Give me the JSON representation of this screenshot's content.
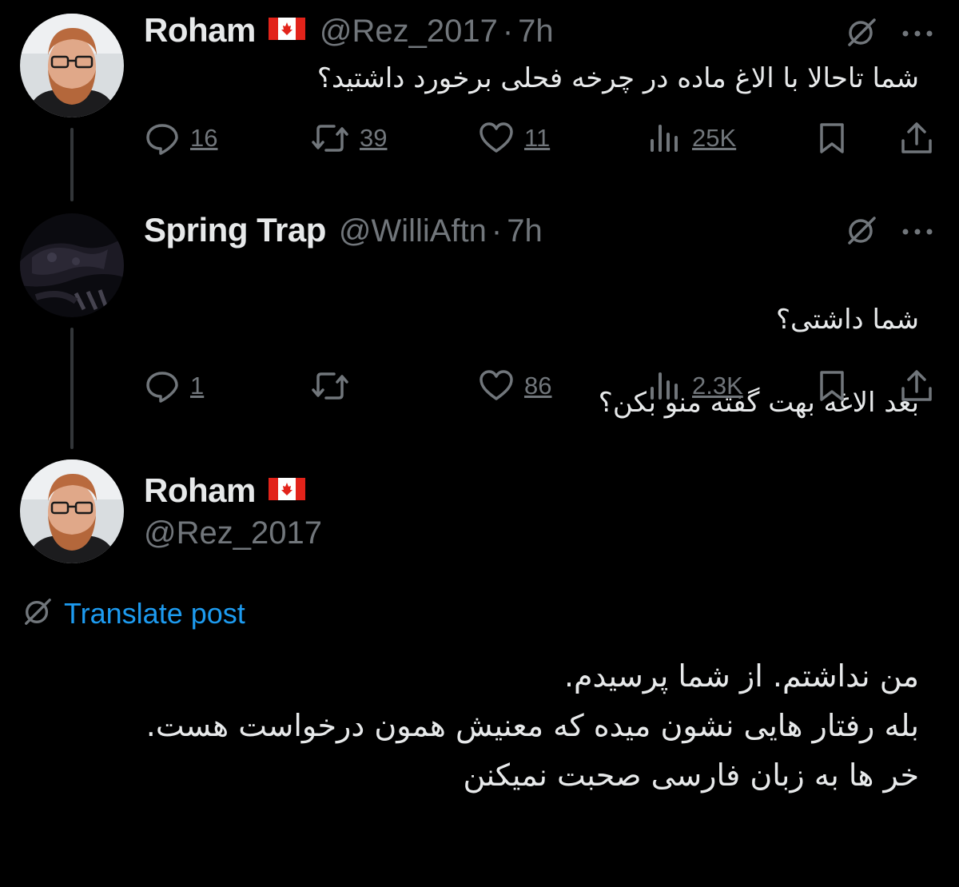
{
  "colors": {
    "background": "#000000",
    "text_primary": "#e7e9ea",
    "text_secondary": "#71767b",
    "link": "#1d9bf0"
  },
  "tweets": [
    {
      "name": "Roham",
      "flag_icon": "canada-flag-icon",
      "handle": "@Rez_2017",
      "dot": "·",
      "time": "7h",
      "text": "شما تاحالا با الاغ ماده در چرخه فحلی برخورد داشتید؟",
      "replies": "16",
      "reposts": "39",
      "likes": "11",
      "views": "25K"
    },
    {
      "name": "Spring Trap",
      "handle": "@WilliAftn",
      "dot": "·",
      "time": "7h",
      "text_lines": [
        "شما داشتی؟",
        "بعد الاغه بهت گفته منو بکن؟"
      ],
      "replies": "1",
      "reposts": "",
      "likes": "86",
      "views": "2.3K"
    }
  ],
  "main_post": {
    "name": "Roham",
    "flag_icon": "canada-flag-icon",
    "handle": "@Rez_2017",
    "translate_label": "Translate post",
    "text_lines": [
      "من نداشتم. از شما پرسیدم.",
      "بله رفتار هایی نشون میده که معنیش همون درخواست هست.",
      "خر ها به زبان فارسی صحبت نمیکنن"
    ]
  }
}
